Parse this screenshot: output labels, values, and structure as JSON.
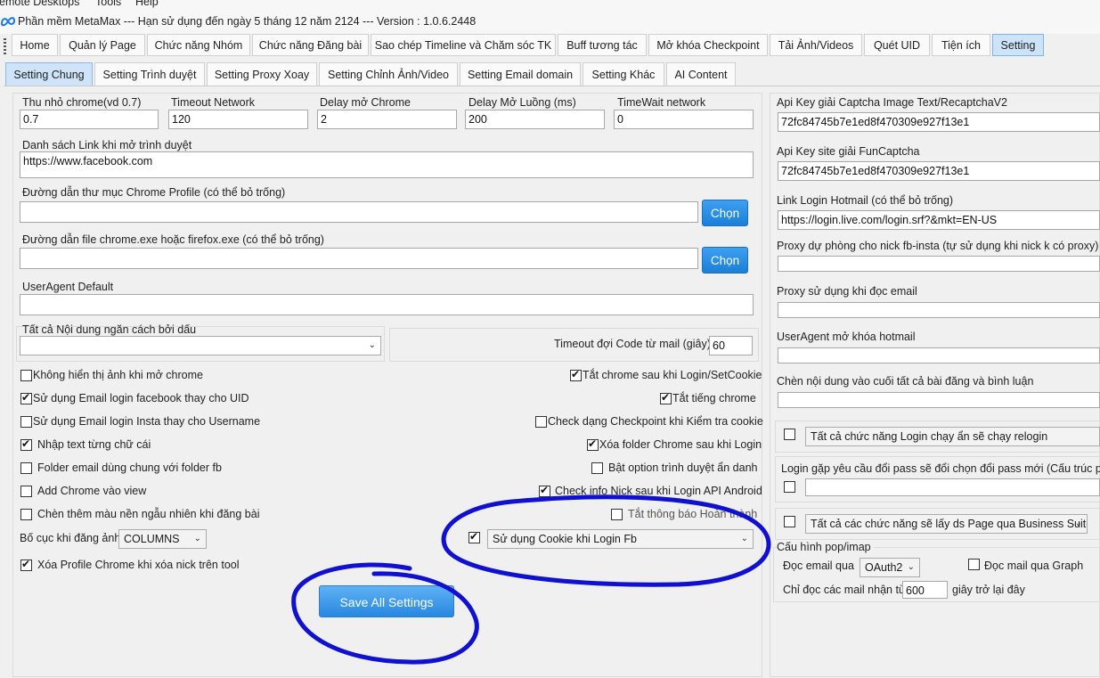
{
  "menu": {
    "items": [
      "Remote Desktops",
      "Tools",
      "Help"
    ]
  },
  "window": {
    "title": "Phần mềm MetaMax --- Hạn sử dụng đến ngày 5 tháng 12 năm 2124 --- Version : 1.0.6.2448"
  },
  "main_tabs": [
    "Home",
    "Quản lý Page",
    "Chức năng Nhóm",
    "Chức năng Đăng bài",
    "Sao chép Timeline và Chăm sóc TK",
    "Buff tương tác",
    "Mở khóa Checkpoint",
    "Tải Ảnh/Videos",
    "Quét UID",
    "Tiện ích",
    "Setting"
  ],
  "sub_tabs": [
    "Setting Chung",
    "Setting Trình duyệt",
    "Setting Proxy Xoay",
    "Setting Chỉnh Ảnh/Video",
    "Setting Email domain",
    "Setting Khác",
    "AI Content"
  ],
  "left": {
    "top_fields": [
      {
        "label": "Thu nhỏ chrome(vd 0.7)",
        "value": "0.7"
      },
      {
        "label": "Timeout Network",
        "value": "120"
      },
      {
        "label": "Delay mở Chrome",
        "value": "2"
      },
      {
        "label": "Delay Mở Luồng (ms)",
        "value": "200"
      },
      {
        "label": "TimeWait network",
        "value": "0"
      }
    ],
    "links_label": "Danh sách Link khi mở trình duyệt",
    "links_value": "https://www.facebook.com",
    "profile_label": "Đường dẫn thư mục Chrome Profile (có thể bỏ trống)",
    "profile_value": "",
    "exe_label": "Đường dẫn file chrome.exe hoặc firefox.exe (có thể bỏ trống)",
    "exe_value": "",
    "choose_label": "Chọn",
    "useragent_label": "UserAgent Default",
    "useragent_value": "",
    "separator_label": "Tất cả Nội dung ngăn cách bởi dấu",
    "separator_value": "",
    "timeout_code_label": "Timeout đợi Code từ mail (giây)",
    "timeout_code_value": "60",
    "checks_left": [
      {
        "label": "Không hiển thị ảnh khi mở chrome",
        "checked": false
      },
      {
        "label": "Sử dụng Email login facebook thay cho UID",
        "checked": true
      },
      {
        "label": "Sử dụng Email login Insta thay cho Username",
        "checked": false
      },
      {
        "label": "Nhập text từng chữ cái",
        "checked": true
      },
      {
        "label": "Folder email dùng chung với folder fb",
        "checked": false
      },
      {
        "label": "Add Chrome vào view",
        "checked": false
      },
      {
        "label": "Chèn thêm màu nền ngẫu nhiên khi đăng bài",
        "checked": false
      }
    ],
    "checks_right": [
      {
        "label": "Tắt chrome sau khi Login/SetCookie",
        "checked": true
      },
      {
        "label": "Tắt tiếng chrome",
        "checked": true
      },
      {
        "label": "Check dạng Checkpoint khi Kiểm tra cookie",
        "checked": false
      },
      {
        "label": "Xóa folder Chrome sau khi Login",
        "checked": true
      },
      {
        "label": "Bật option trình duyệt ẩn danh",
        "checked": false
      },
      {
        "label": "Check info Nick sau khi Login API Android",
        "checked": true
      },
      {
        "label": "Tắt thông báo Hoàn thành",
        "checked": false
      }
    ],
    "layout_label": "Bố cục khi đăng ảnh",
    "layout_value": "COLUMNS",
    "cookie_select": "Sử dụng Cookie khi Login Fb",
    "cookie_checked": true,
    "delete_profile_label": "Xóa Profile Chrome khi xóa nick trên tool",
    "delete_profile_checked": true,
    "save_label": "Save All Settings"
  },
  "right": {
    "fields": [
      {
        "label": "Api Key giải Captcha Image Text/RecaptchaV2",
        "value": "72fc84745b7e1ed8f470309e927f13e1"
      },
      {
        "label": "Api Key site giải FunCaptcha",
        "value": "72fc84745b7e1ed8f470309e927f13e1"
      },
      {
        "label": "Link Login Hotmail (có thể bỏ trống)",
        "value": "https://login.live.com/login.srf?&mkt=EN-US"
      },
      {
        "label": "Proxy dự phòng cho nick fb-insta (tự sử dụng khi nick k có proxy)",
        "value": ""
      },
      {
        "label": "Proxy sử dụng khi đọc email",
        "value": ""
      },
      {
        "label": "UserAgent mở khóa hotmail",
        "value": ""
      },
      {
        "label": "Chèn nội dung vào cuối tất cả bài đăng và bình luận",
        "value": ""
      }
    ],
    "relogin_select": "Tất cả chức năng Login chạy ẩn sẽ chạy relogin",
    "relogin_checked": false,
    "changepass_label": "Login gặp yêu cầu đổi pass sẽ đổi chọn đổi pass mới (Cấu trúc pass",
    "changepass_checked": false,
    "changepass_value": "",
    "page_select": "Tất cả các chức năng sẽ lấy ds Page qua Business Suite",
    "page_checked": false,
    "popimap_label": "Cấu hình pop/imap",
    "read_via_label": "Đọc email qua",
    "read_via_value": "OAuth2",
    "graph_label": "Đọc mail qua Graph",
    "graph_checked": false,
    "only_read_label": "Chỉ đọc các mail nhận từ",
    "only_read_value": "600",
    "seconds_label": "giây trở lại đây"
  },
  "colors": {
    "accent": "#1b7fd8",
    "annotation": "#1010d0",
    "active_tab": "#cde3f7"
  }
}
